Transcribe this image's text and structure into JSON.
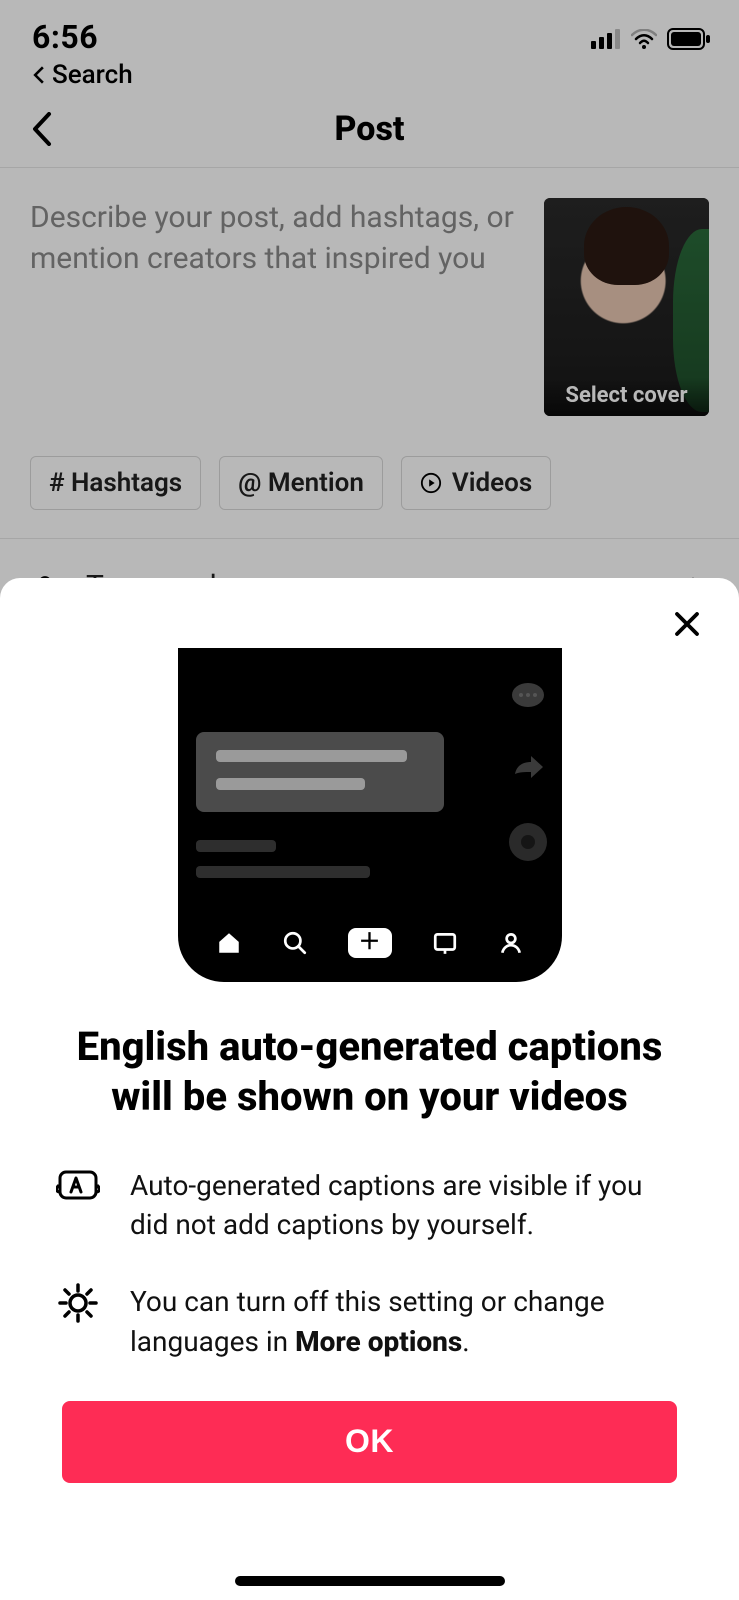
{
  "status": {
    "time": "6:56",
    "back_label": "Search"
  },
  "nav": {
    "title": "Post"
  },
  "compose": {
    "placeholder": "Describe your post, add hashtags, or mention creators that inspired you",
    "cover_label": "Select cover",
    "chips": {
      "hashtags": "# Hashtags",
      "mention": "@ Mention",
      "videos": "Videos"
    },
    "row_tag_people": "Tag people"
  },
  "sheet": {
    "title": "English auto-generated captions will be shown on your videos",
    "bullets": {
      "b1": "Auto-generated captions are visible if you did not add captions by yourself.",
      "b2_pre": "You can turn off this setting or change languages in ",
      "b2_bold": "More options",
      "b2_post": "."
    },
    "ok": "OK"
  }
}
